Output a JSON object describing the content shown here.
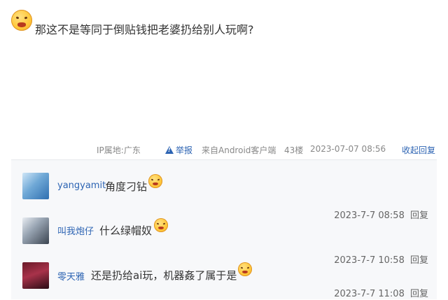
{
  "post": {
    "text": "那这不是等同于倒贴钱把老婆扔给别人玩啊?",
    "emoji_icon": "grinning-emoji-icon"
  },
  "meta": {
    "ip": "IP属地:广东",
    "report": "举报",
    "source": "来自Android客户端",
    "floor": "43楼",
    "time": "2023-07-07 08:56",
    "collapse_reply": "收起回复"
  },
  "replies": [
    {
      "user": "yangyamit",
      "text": "角度刁钻",
      "time": "2023-7-7 08:58",
      "reply": "回复",
      "emoji_icon": "smirk-emoji-icon"
    },
    {
      "user": "叫我炮仔",
      "text": "什么绿帽奴",
      "time": "2023-7-7 10:58",
      "reply": "回复",
      "emoji_icon": "angry-emoji-icon"
    },
    {
      "user": "零天雅",
      "text": "还是扔给ai玩，机器姦了属于是",
      "time": "2023-7-7 11:08",
      "reply": "回复",
      "emoji_icon": "grin-emoji-icon"
    }
  ],
  "colors": {
    "link_blue": "#2d64b3",
    "panel_bg": "#f7f8fa",
    "meta_gray": "#888888"
  }
}
